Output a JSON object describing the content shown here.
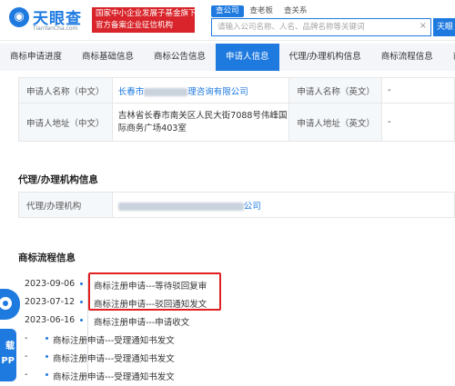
{
  "header": {
    "logo_name": "天眼查",
    "logo_url": "TianYanCha.com",
    "banner_line1": "国家中小企业发展子基金旗下",
    "banner_line2": "官方备案企业征信机构",
    "search_tabs": [
      "查公司",
      "查老板",
      "查关系"
    ],
    "search_placeholder": "请输入公司名称、人名、品牌名称等关键词",
    "search_clear": "×",
    "search_button": "天眼"
  },
  "tabs": [
    "商标申请进度",
    "商标基础信息",
    "商标公告信息",
    "申请人信息",
    "代理/办理机构信息",
    "商标流程信息",
    "商"
  ],
  "applicant": {
    "name_cn_label": "申请人名称（中文）",
    "name_cn_prefix": "长春市",
    "name_cn_suffix": "理咨询有限公司",
    "name_en_label": "申请人名称（英文）",
    "name_en_value": "-",
    "addr_cn_label": "申请人地址（中文）",
    "addr_cn_value": "吉林省长春市南关区人民大街7088号伟峰国际商务广场403室",
    "addr_en_label": "申请人地址（英文）",
    "addr_en_value": "-"
  },
  "agency": {
    "title": "代理/办理机构信息",
    "label": "代理/办理机构",
    "value_suffix": "公司"
  },
  "flow": {
    "title": "商标流程信息",
    "items": [
      {
        "date": "2023-09-06",
        "text": "商标注册申请---等待驳回复审"
      },
      {
        "date": "2023-07-12",
        "text": "商标注册申请---驳回通知发文"
      },
      {
        "date": "2023-06-16",
        "text": "商标注册申请---申请收文"
      },
      {
        "date": "-",
        "text": "商标注册申请---受理通知书发文"
      },
      {
        "date": "-",
        "text": "商标注册申请---受理通知书发文"
      },
      {
        "date": "-",
        "text": "商标注册申请---受理通知书发文"
      }
    ]
  },
  "app_widget": {
    "label_line1": "载",
    "label_line2": "PP"
  },
  "colors": {
    "brand": "#1f7ae0",
    "highlight_box": "#e02020",
    "banner": "#d8242a"
  }
}
